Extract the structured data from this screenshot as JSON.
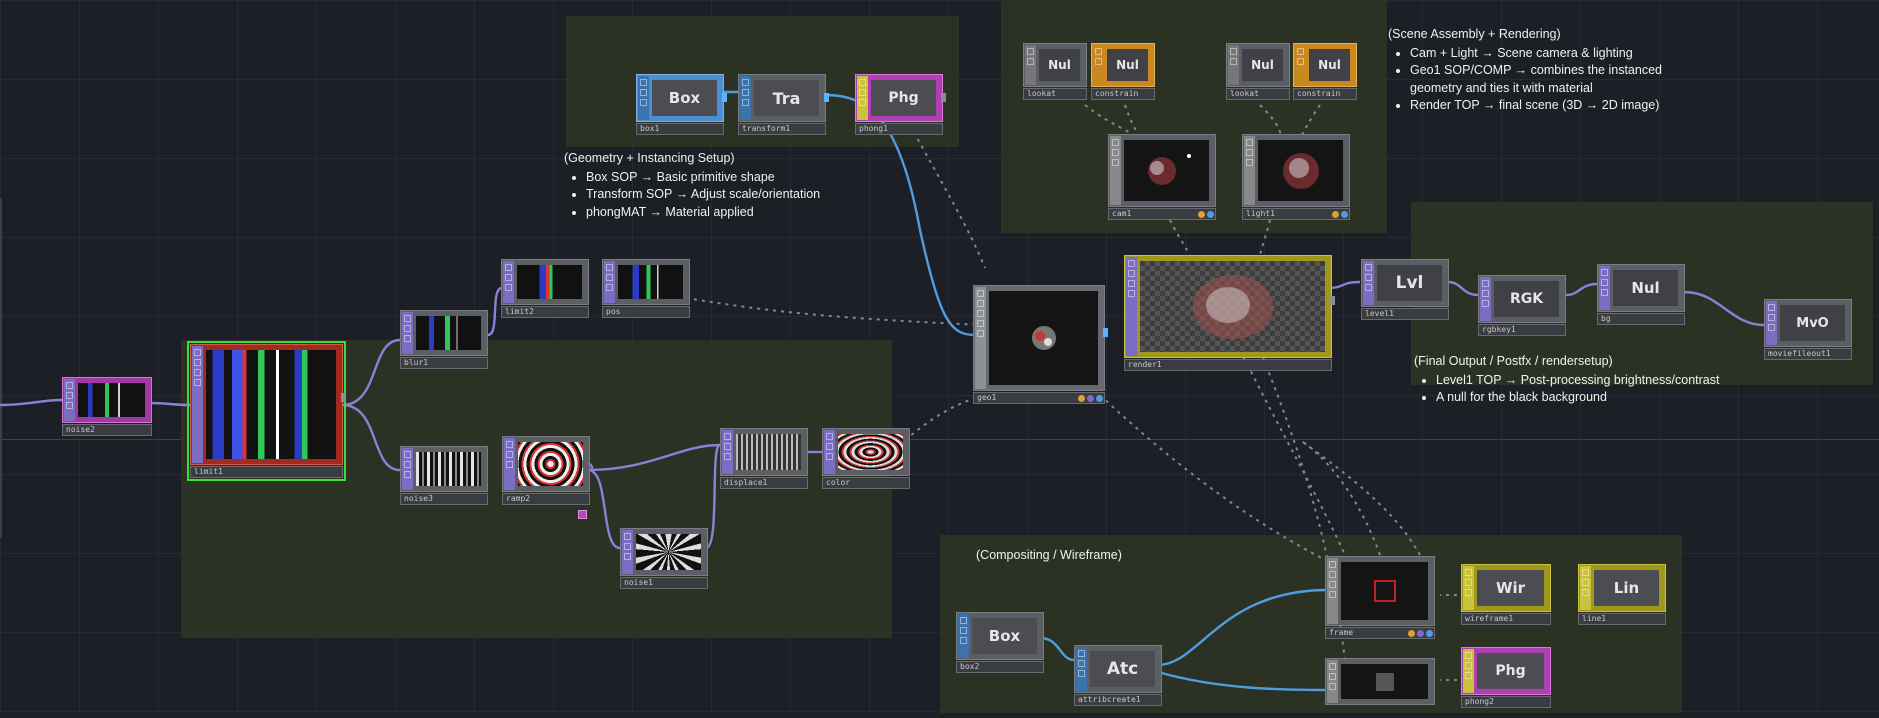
{
  "annotations": {
    "geometry": {
      "title": "(Geometry + Instancing Setup)",
      "items": [
        "Box SOP → Basic primitive shape",
        "Transform SOP → Adjust scale/orientation",
        "phongMAT → Material applied"
      ]
    },
    "scene": {
      "title": "(Scene Assembly + Rendering)",
      "items": [
        "Cam + Light → Scene camera & lighting",
        "Geo1 SOP/COMP → combines the instanced geometry and ties it with material",
        "Render TOP → final scene (3D → 2D image)"
      ]
    },
    "final": {
      "title": "(Final Output / Postfx / rendersetup)",
      "items": [
        "Level1 TOP → Post-processing brightness/contrast",
        "A null for the black background"
      ]
    },
    "compositing": {
      "title": "(Compositing / Wireframe)"
    }
  },
  "nodes": {
    "box1": {
      "name": "box1",
      "icon": "Box"
    },
    "transform1": {
      "name": "transform1",
      "icon": "Tra"
    },
    "phong1": {
      "name": "phong1",
      "icon": "Phg"
    },
    "null_a": {
      "name": "",
      "icon": "Nul"
    },
    "null_b": {
      "name": "",
      "icon": "Nul"
    },
    "null_c": {
      "name": "",
      "icon": "Nul"
    },
    "null_d": {
      "name": "",
      "icon": "Nul"
    },
    "lookat1": {
      "name": "lookat"
    },
    "constrain1": {
      "name": "constrain"
    },
    "lookat2": {
      "name": "lookat"
    },
    "constrain2": {
      "name": "constrain"
    },
    "cam1": {
      "name": "cam1"
    },
    "light1": {
      "name": "light1"
    },
    "noise2": {
      "name": "noise2"
    },
    "limit1": {
      "name": "limit1"
    },
    "blur1": {
      "name": "blur1"
    },
    "limit2": {
      "name": "limit2"
    },
    "pos": {
      "name": "pos"
    },
    "noise3": {
      "name": "noise3"
    },
    "ramp2": {
      "name": "ramp2"
    },
    "displace1": {
      "name": "displace1"
    },
    "color": {
      "name": "color"
    },
    "noise1": {
      "name": "noise1"
    },
    "geo1": {
      "name": "geo1"
    },
    "render1": {
      "name": "render1"
    },
    "level1": {
      "name": "level1",
      "icon": "Lvl"
    },
    "rgbkey1": {
      "name": "rgbkey1",
      "icon": "RGK"
    },
    "bg": {
      "name": "bg",
      "icon": "Nul"
    },
    "moviefileout1": {
      "name": "moviefileout1",
      "icon": "MvO"
    },
    "frame": {
      "name": "frame"
    },
    "wireframe1": {
      "name": "wireframe1",
      "icon": "Wir"
    },
    "line1": {
      "name": "line1",
      "icon": "Lin"
    },
    "box2": {
      "name": "box2",
      "icon": "Box"
    },
    "attribcreate1": {
      "name": "attribcreate1",
      "icon": "Atc"
    },
    "phong2": {
      "name": "phong2",
      "icon": "Phg"
    },
    "solid": {
      "name": ""
    }
  },
  "colors": {
    "sop": "#5a8fd0",
    "top": "#7b6cc4",
    "mat": "#b4b03a",
    "comp": "#8d9196",
    "chop": "#d8992d",
    "dat": "#b04ab3",
    "selected": "#3ddc3d",
    "wire_top": "#8d7fd8",
    "wire_sop": "#4f9de0",
    "annotation_bg": "#2c3223"
  }
}
